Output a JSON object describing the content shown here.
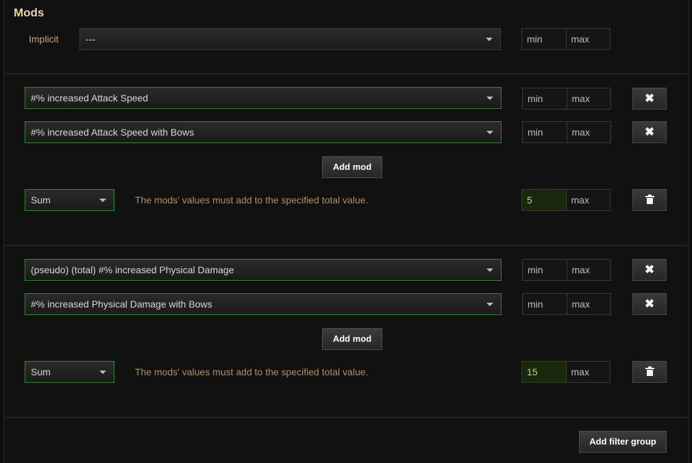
{
  "section": {
    "title": "Mods"
  },
  "implicit": {
    "label": "Implicit",
    "selected": "---",
    "min_placeholder": "min",
    "max_placeholder": "max"
  },
  "groups": [
    {
      "mods": [
        {
          "selected": "#% increased Attack Speed",
          "min": "min",
          "max": "max",
          "remove_icon": "✖"
        },
        {
          "selected": "#% increased Attack Speed with Bows",
          "min": "min",
          "max": "max",
          "remove_icon": "✖"
        }
      ],
      "add_mod_label": "Add mod",
      "type": "Sum",
      "description": "The mods' values must add to the specified total value.",
      "total_min": "5",
      "total_max": "max"
    },
    {
      "mods": [
        {
          "selected": "(pseudo) (total) #% increased Physical Damage",
          "min": "min",
          "max": "max",
          "remove_icon": "✖"
        },
        {
          "selected": "#% increased Physical Damage with Bows",
          "min": "min",
          "max": "max",
          "remove_icon": "✖"
        }
      ],
      "add_mod_label": "Add mod",
      "type": "Sum",
      "description": "The mods' values must add to the specified total value.",
      "total_min": "15",
      "total_max": "max"
    }
  ],
  "add_filter_group_label": "Add filter group",
  "colors": {
    "accent_green": "#2f8a2f",
    "title": "#e5d7a8",
    "hint": "#b48f63",
    "filled_value_bg": "#17280d"
  }
}
